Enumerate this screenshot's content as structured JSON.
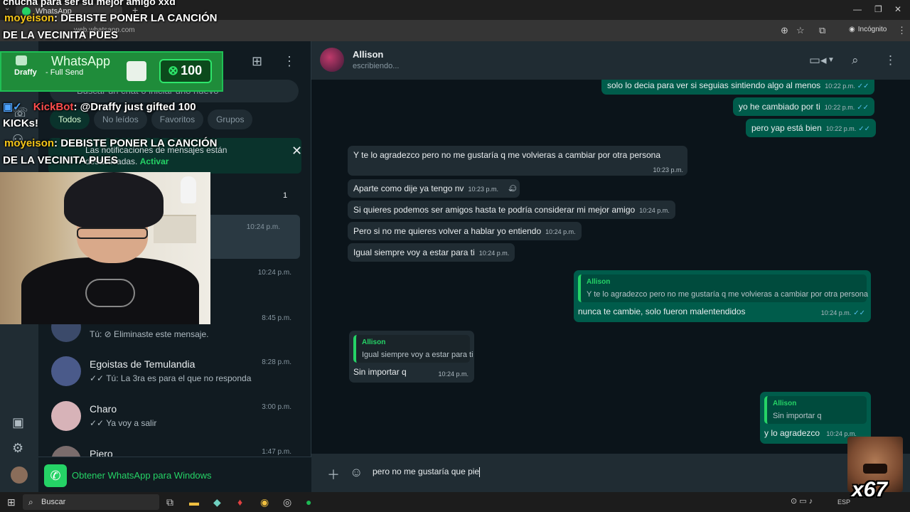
{
  "browser": {
    "tab_title": "WhatsApp",
    "url": "web.whatsapp.com",
    "incognito_label": "Incógnito"
  },
  "sidebar": {
    "search_placeholder": "Buscar un chat o iniciar uno nuevo",
    "filters": [
      "Todos",
      "No leídos",
      "Favoritos",
      "Grupos"
    ],
    "notification": {
      "line1": "Las notificaciones de mensajes están",
      "line2": "desactivadas.",
      "action": "Activar"
    },
    "unread_count": "1",
    "chats": [
      {
        "time": "10:24 p.m."
      },
      {
        "time": "10:24 p.m."
      },
      {
        "time": "8:45 p.m.",
        "last": "Tú: ⊘ Eliminaste este mensaje."
      },
      {
        "name": "Egoistas de Temulandia",
        "time": "8:28 p.m.",
        "last": "✓✓ Tú: La 3ra es para el que no responda"
      },
      {
        "name": "Charo",
        "time": "3:00 p.m.",
        "last": "✓✓ Ya voy a salir"
      },
      {
        "name": "Piero",
        "time": "1:47 p.m."
      }
    ],
    "get_windows": "Obtener WhatsApp para Windows"
  },
  "conversation": {
    "contact_name": "Allison",
    "contact_status": "escribiendo...",
    "messages": [
      {
        "text": "solo lo decia para ver si seguias sintiendo algo al menos",
        "time": "10:22 p.m."
      },
      {
        "text": "yo he cambiado por ti",
        "time": "10:22 p.m."
      },
      {
        "text": "pero yap está bien",
        "time": "10:22 p.m."
      },
      {
        "text": "Y te lo agradezco pero no me gustaría q me volvieras a cambiar por otra persona",
        "time": "10:23 p.m."
      },
      {
        "text": "Aparte como dije ya tengo nv",
        "time": "10:23 p.m."
      },
      {
        "text": "Si quieres podemos ser amigos hasta te podría considerar mi mejor amigo",
        "time": "10:24 p.m."
      },
      {
        "text": "Pero si no me quieres volver a hablar yo entiendo",
        "time": "10:24 p.m."
      },
      {
        "text": "Igual siempre voy a estar para ti",
        "time": "10:24 p.m."
      },
      {
        "quote_name": "Allison",
        "quote_text": "Y te lo agradezco pero no me gustaría q me volvieras a cambiar por otra persona",
        "text": "nunca te cambie, solo fueron malentendidos",
        "time": "10:24 p.m."
      },
      {
        "quote_name": "Allison",
        "quote_text": "Igual siempre voy a estar para ti",
        "text": "Sin importar q",
        "time": "10:24 p.m."
      },
      {
        "quote_name": "Allison",
        "quote_text": "Sin importar q",
        "text": "y lo agradezco",
        "time": "10:24 p.m."
      }
    ],
    "compose_text": "pero no me gustaría que pie"
  },
  "taskbar": {
    "search_label": "Buscar",
    "lang": "ESP"
  },
  "overlay": {
    "chat_line_top": "chucha para ser su mejor amigo xxd",
    "user1": "moyeison",
    "msg1": ": DEBISTE PONER LA CANCIÓN",
    "msg1b": "DE LA VECINITA PUES",
    "gift_title": "WhatsApp",
    "gift_user": "Draffy",
    "gift_action": "- Full Send",
    "gift_amount": "100",
    "bot": "KickBot",
    "bot_msg": ": @Draffy just gifted 100",
    "bot_msg2": "KICKs!",
    "user2": "moyeison",
    "msg2": ": DEBISTE PONER LA CANCIÓN",
    "msg2b": "DE LA VECINITA PUES",
    "emote_label": "x67"
  }
}
